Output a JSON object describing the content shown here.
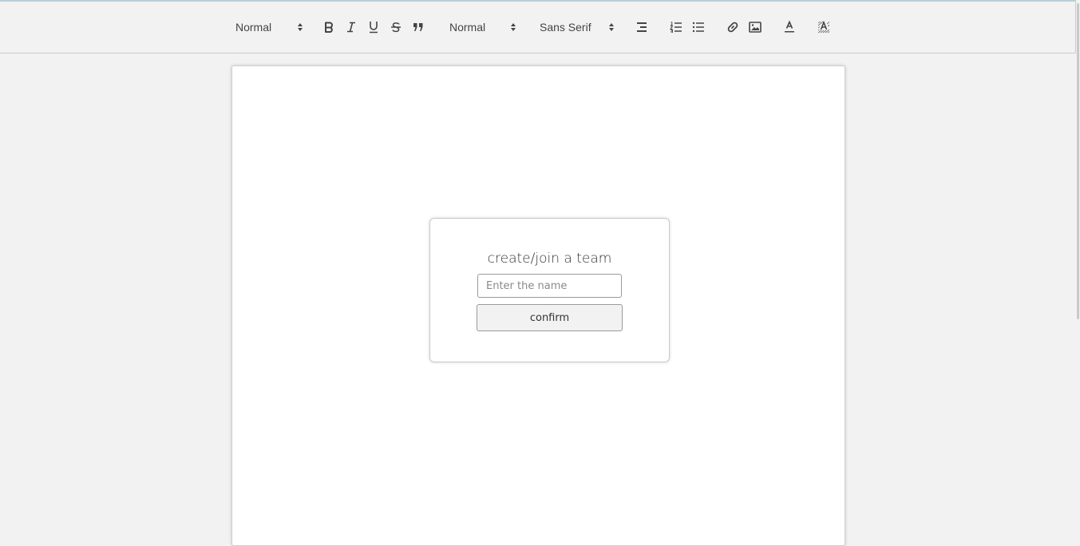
{
  "toolbar": {
    "header_select": "Normal",
    "size_select": "Normal",
    "font_select": "Sans Serif",
    "icons": [
      "bold-icon",
      "italic-icon",
      "underline-icon",
      "strike-icon",
      "blockquote-icon",
      "align-icon",
      "ordered-list-icon",
      "bullet-list-icon",
      "link-icon",
      "image-icon",
      "text-color-icon",
      "clean-format-icon"
    ]
  },
  "dialog": {
    "title": "create/join a team",
    "input_placeholder": "Enter the name",
    "input_value": "",
    "confirm_label": "confirm"
  },
  "colors": {
    "background": "#f2f2f2",
    "page": "#ffffff",
    "text": "#444444",
    "border": "#9a9a9a"
  }
}
